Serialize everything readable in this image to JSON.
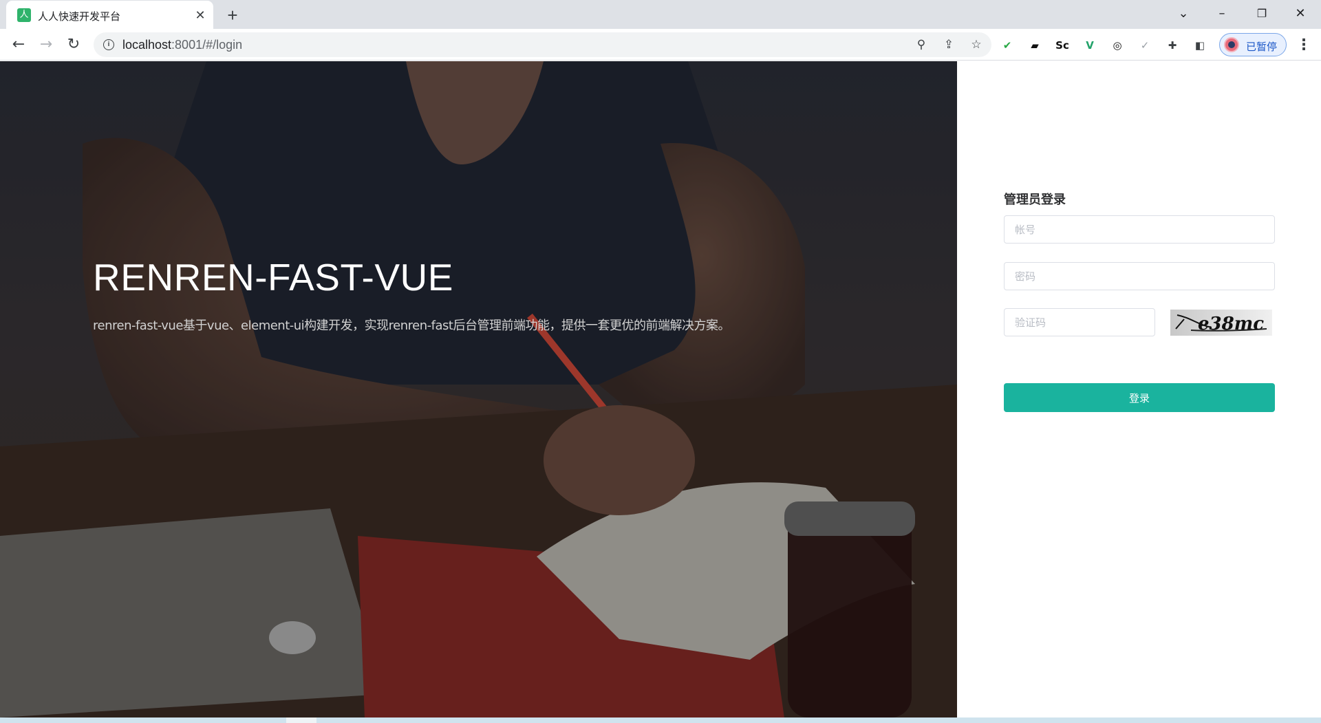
{
  "browser": {
    "tab_title": "人人快速开发平台",
    "tab_favicon_glyph": "人",
    "url_host": "localhost",
    "url_rest": ":8001/#/login",
    "profile_label": "已暂停",
    "extensions": [
      {
        "name": "adblock-shield-icon",
        "glyph": "✔",
        "color": "#27a844"
      },
      {
        "name": "dark-reader-icon",
        "glyph": "▰",
        "color": "#111111"
      },
      {
        "name": "scraper-icon",
        "glyph": "Sc",
        "color": "#111111"
      },
      {
        "name": "vue-devtools-icon",
        "glyph": "V",
        "color": "#24a36b"
      },
      {
        "name": "link-extension-icon",
        "glyph": "◎",
        "color": "#111111"
      },
      {
        "name": "check-extension-icon",
        "glyph": "✓",
        "color": "#9aa0a6"
      },
      {
        "name": "extensions-puzzle-icon",
        "glyph": "✚",
        "color": "#3c4043"
      },
      {
        "name": "side-panel-icon",
        "glyph": "◧",
        "color": "#3c4043"
      }
    ]
  },
  "hero": {
    "title": "RENREN-FAST-VUE",
    "description": "renren-fast-vue基于vue、element-ui构建开发，实现renren-fast后台管理前端功能，提供一套更优的前端解决方案。"
  },
  "login": {
    "title": "管理员登录",
    "username_placeholder": "帐号",
    "password_placeholder": "密码",
    "captcha_placeholder": "验证码",
    "captcha_text": "e38mc",
    "submit_label": "登录"
  },
  "colors": {
    "accent": "#1ab39e",
    "input_border": "#dcdfe6"
  }
}
